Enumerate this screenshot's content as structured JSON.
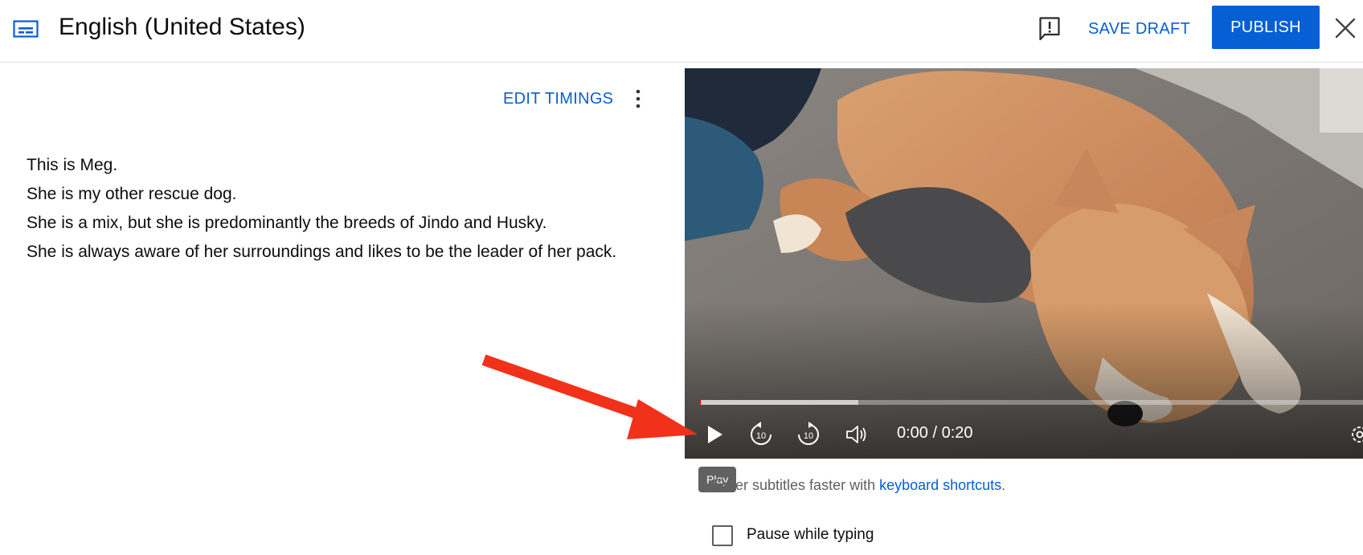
{
  "header": {
    "subtitles_icon": "subtitles-icon",
    "title": "English (United States)",
    "feedback_icon": "feedback-icon",
    "save_draft_label": "SAVE DRAFT",
    "publish_label": "PUBLISH",
    "close_icon": "close-icon"
  },
  "editor": {
    "edit_timings_label": "EDIT TIMINGS",
    "more_icon": "more-vert-icon",
    "transcript_lines": [
      "This is Meg.",
      "She is my other rescue dog.",
      "She is a mix, but she is predominantly the breeds of Jindo and Husky.",
      "She is always aware of her surroundings and likes to be the leader of her pack."
    ]
  },
  "player": {
    "time_display": "0:00 / 0:20",
    "progress_fraction": 0,
    "buffered_fraction": 0.24,
    "controls": [
      "play-icon",
      "rewind-10-icon",
      "forward-10-icon",
      "volume-icon",
      "settings-icon"
    ],
    "tooltip": "Play"
  },
  "below_video": {
    "hint_prefix": "Enter subtitles faster with ",
    "hint_link": "keyboard shortcuts",
    "hint_suffix": ".",
    "pause_while_typing_label": "Pause while typing",
    "pause_while_typing_checked": false
  },
  "colors": {
    "accent": "#065fd4",
    "annotation_arrow": "#f2311a",
    "progress_played": "#ff0000"
  }
}
